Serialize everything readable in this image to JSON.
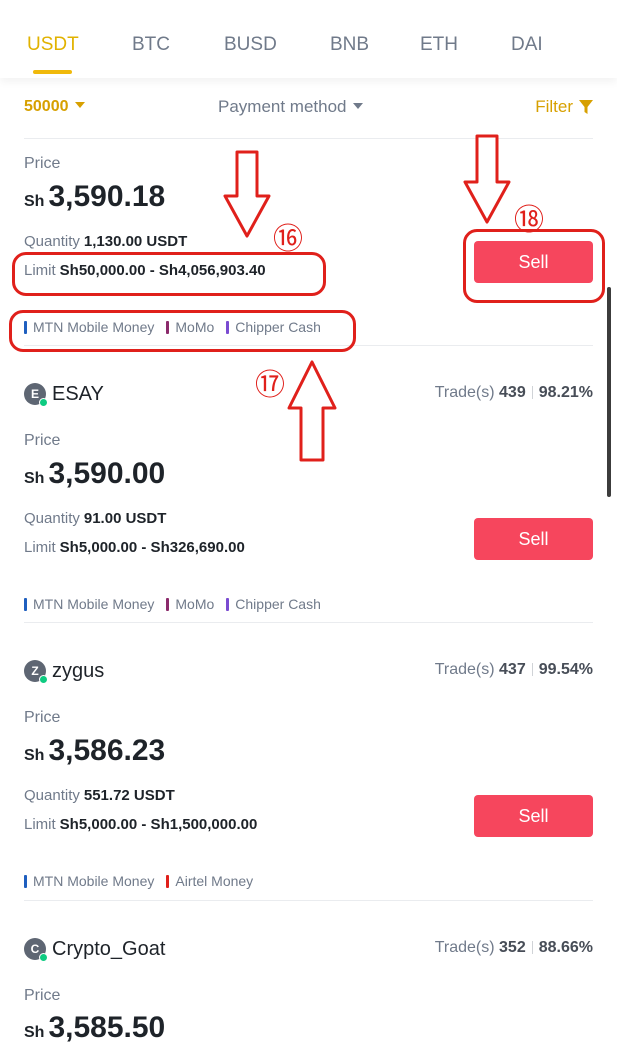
{
  "tabs": [
    "USDT",
    "BTC",
    "BUSD",
    "BNB",
    "ETH",
    "DAI"
  ],
  "active_tab": "USDT",
  "filters": {
    "amount": "50000",
    "payment_method": "Payment method",
    "filter": "Filter"
  },
  "offers": [
    {
      "price_label": "Price",
      "currency": "Sh",
      "price": "3,590.18",
      "quantity_label": "Quantity",
      "quantity": "1,130.00 USDT",
      "limit_label": "Limit",
      "limit": "Sh50,000.00 - Sh4,056,903.40",
      "sell_label": "Sell",
      "payments": [
        {
          "name": "MTN Mobile Money",
          "color": "#1f5fbf"
        },
        {
          "name": "MoMo",
          "color": "#8b2a6b"
        },
        {
          "name": "Chipper Cash",
          "color": "#7a4bd1"
        }
      ]
    },
    {
      "avatar": "E",
      "name": "ESAY",
      "trades_label": "Trade(s)",
      "trades": "439",
      "completion": "98.21%",
      "price_label": "Price",
      "currency": "Sh",
      "price": "3,590.00",
      "quantity_label": "Quantity",
      "quantity": "91.00 USDT",
      "limit_label": "Limit",
      "limit": "Sh5,000.00 - Sh326,690.00",
      "sell_label": "Sell",
      "payments": [
        {
          "name": "MTN Mobile Money",
          "color": "#1f5fbf"
        },
        {
          "name": "MoMo",
          "color": "#8b2a6b"
        },
        {
          "name": "Chipper Cash",
          "color": "#7a4bd1"
        }
      ]
    },
    {
      "avatar": "Z",
      "name": "zygus",
      "trades_label": "Trade(s)",
      "trades": "437",
      "completion": "99.54%",
      "price_label": "Price",
      "currency": "Sh",
      "price": "3,586.23",
      "quantity_label": "Quantity",
      "quantity": "551.72 USDT",
      "limit_label": "Limit",
      "limit": "Sh5,000.00 - Sh1,500,000.00",
      "sell_label": "Sell",
      "payments": [
        {
          "name": "MTN Mobile Money",
          "color": "#1f5fbf"
        },
        {
          "name": "Airtel Money",
          "color": "#e0201b"
        }
      ]
    },
    {
      "avatar": "C",
      "name": "Crypto_Goat",
      "trades_label": "Trade(s)",
      "trades": "352",
      "completion": "88.66%",
      "price_label": "Price",
      "currency": "Sh",
      "price": "3,585.50"
    }
  ],
  "annotations": {
    "n16": "⑯",
    "n17": "⑰",
    "n18": "⑱"
  },
  "colors": {
    "accent": "#f0b90b",
    "sell": "#f6465d",
    "annotation": "#e0201b"
  }
}
